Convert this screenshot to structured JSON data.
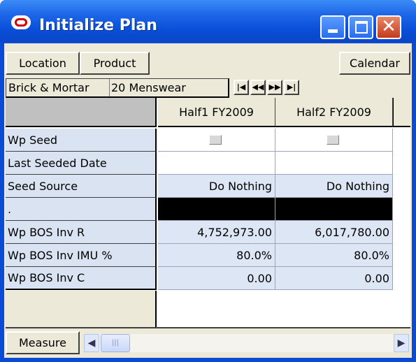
{
  "window": {
    "title": "Initialize Plan",
    "controls": {
      "minimize": "minimize-icon",
      "maximize": "maximize-icon",
      "close": "close-icon"
    }
  },
  "toolbar": {
    "location_label": "Location",
    "product_label": "Product",
    "calendar_label": "Calendar"
  },
  "context": {
    "location_value": "Brick & Mortar",
    "product_value": "20 Menswear",
    "nav_icons": [
      "first-icon",
      "prev-icon",
      "next-icon",
      "last-icon"
    ]
  },
  "grid": {
    "columns": [
      "Half1 FY2009",
      "Half2 FY2009"
    ],
    "rows": [
      {
        "label": "Wp Seed",
        "values": [
          "",
          ""
        ],
        "kind": "checkbox"
      },
      {
        "label": "Last Seeded Date",
        "values": [
          "",
          ""
        ],
        "kind": "text"
      },
      {
        "label": "Seed Source",
        "values": [
          "Do Nothing",
          "Do Nothing"
        ],
        "kind": "text"
      },
      {
        "label": ".",
        "values": [
          "",
          ""
        ],
        "kind": "black"
      },
      {
        "label": "Wp BOS Inv R",
        "values": [
          "4,752,973.00",
          "6,017,780.00"
        ],
        "kind": "text"
      },
      {
        "label": "Wp BOS Inv IMU %",
        "values": [
          "80.0%",
          "80.0%"
        ],
        "kind": "text"
      },
      {
        "label": "Wp BOS Inv C",
        "values": [
          "0.00",
          "0.00"
        ],
        "kind": "text"
      }
    ]
  },
  "bottom": {
    "measure_label": "Measure",
    "scroll_icons": [
      "scroll-left-icon",
      "scroll-right-icon"
    ]
  },
  "colors": {
    "title_bar": "#0a4fd8",
    "row_label_bg": "#d9e3f1",
    "cell_bg": "#dde6f4",
    "face": "#ece9d8"
  }
}
